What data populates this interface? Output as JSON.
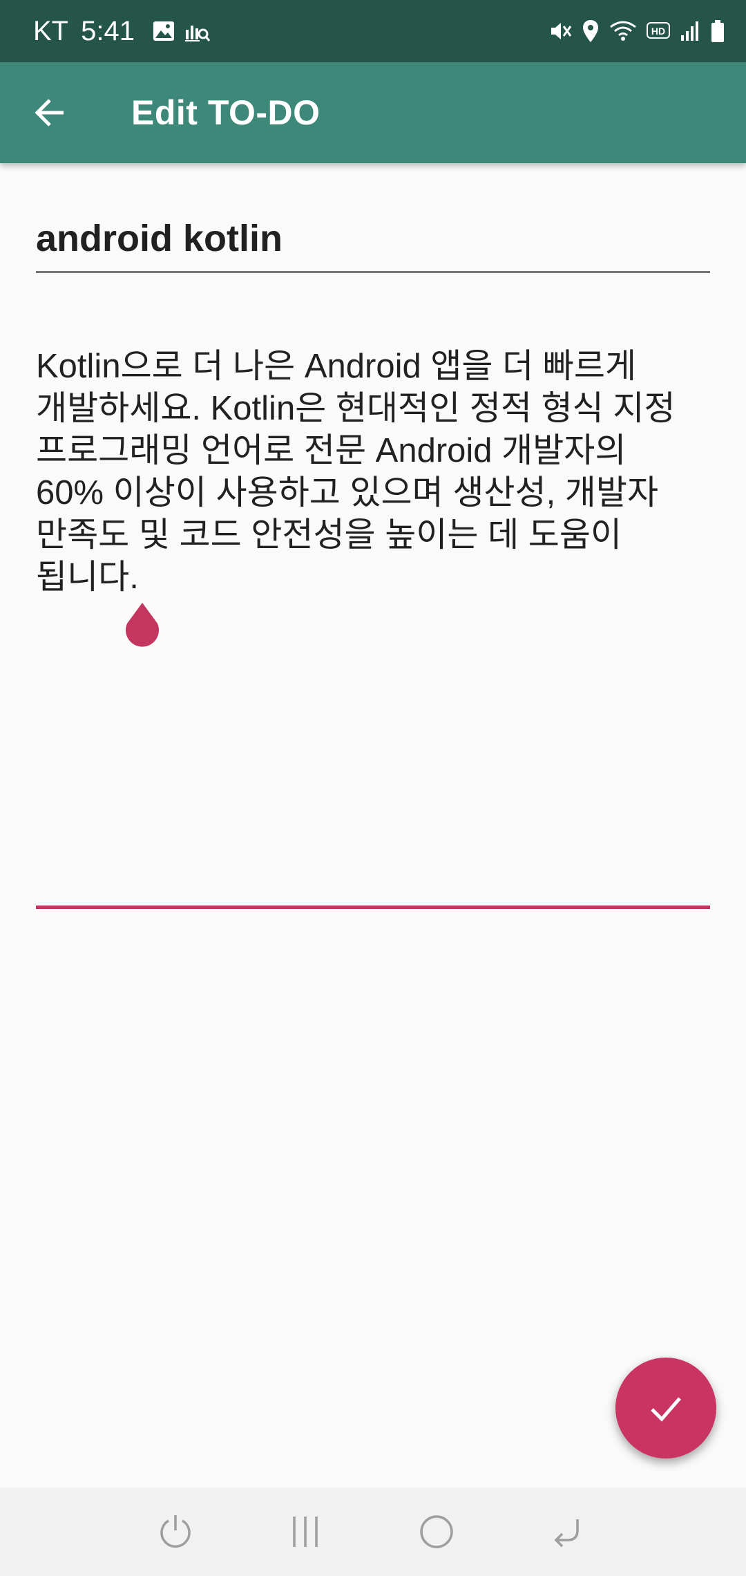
{
  "status_bar": {
    "carrier": "KT",
    "time": "5:41",
    "left_icons": [
      "image-icon",
      "analytics-search-icon"
    ],
    "right_icons": [
      "mute-vibrate-icon",
      "location-icon",
      "wifi-icon",
      "hd-icon",
      "signal-icon",
      "battery-icon"
    ],
    "hd_label": "HD"
  },
  "app_bar": {
    "title": "Edit TO-DO",
    "back_icon": "arrow-back-icon",
    "color": "#3d8878"
  },
  "editor": {
    "title_value": "android kotlin",
    "body_value": "Kotlin으로 더 나은 Android 앱을 더 빠르게\n개발하세요. Kotlin은 현대적인 정적 형식 지정\n프로그래밍 언어로 전문 Android 개발자의\n60% 이상이 사용하고 있으며 생산성, 개발자\n만족도 및 코드 안전성을 높이는 데 도움이\n됩니다.",
    "accent_color": "#c2365f"
  },
  "fab": {
    "icon": "check-icon",
    "color": "#c93462"
  },
  "nav_bar": {
    "buttons": [
      "power-icon",
      "recents-icon",
      "home-icon",
      "back-nav-icon"
    ]
  }
}
